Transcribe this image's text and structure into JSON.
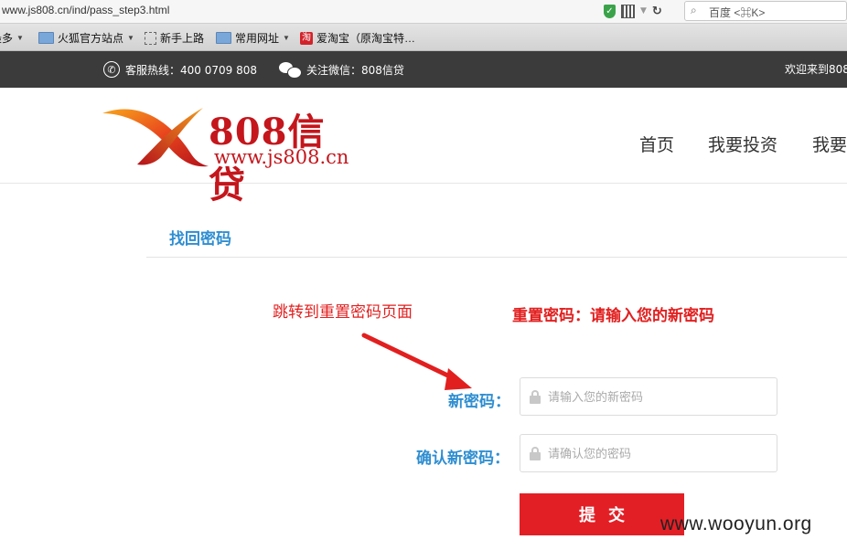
{
  "browser": {
    "url": "www.js808.cn/ind/pass_step3.html",
    "search_placeholder": "百度 <⌘K>"
  },
  "bookmarks": [
    {
      "label": "最多",
      "icon": "none"
    },
    {
      "label": "火狐官方站点",
      "icon": "folder-icon"
    },
    {
      "label": "新手上路",
      "icon": "page-icon"
    },
    {
      "label": "常用网址",
      "icon": "folder-icon"
    },
    {
      "label": "爱淘宝（原淘宝特…",
      "icon": "taobao-icon"
    }
  ],
  "topbar": {
    "hotline": "客服热线：400 0709 808",
    "wechat": "关注微信：808信贷",
    "welcome": "欢迎来到808"
  },
  "header": {
    "logo_title": "808信贷",
    "logo_url": "www.js808.cn",
    "nav": [
      "首页",
      "我要投资",
      "我要"
    ]
  },
  "content": {
    "section_title": "找回密码",
    "annotation_left": "跳转到重置密码页面",
    "annotation_right": "重置密码：请输入您的新密码",
    "new_password_label": "新密码：",
    "new_password_placeholder": "请输入您的新密码",
    "confirm_label": "确认新密码：",
    "confirm_placeholder": "请确认您的密码",
    "submit_label": "提交"
  },
  "watermark": "www.wooyun.org",
  "colors": {
    "accent_blue": "#2f8ed1",
    "brand_red": "#c4161c",
    "button_red": "#e31f26",
    "topbar_bg": "#3b3b3b"
  }
}
